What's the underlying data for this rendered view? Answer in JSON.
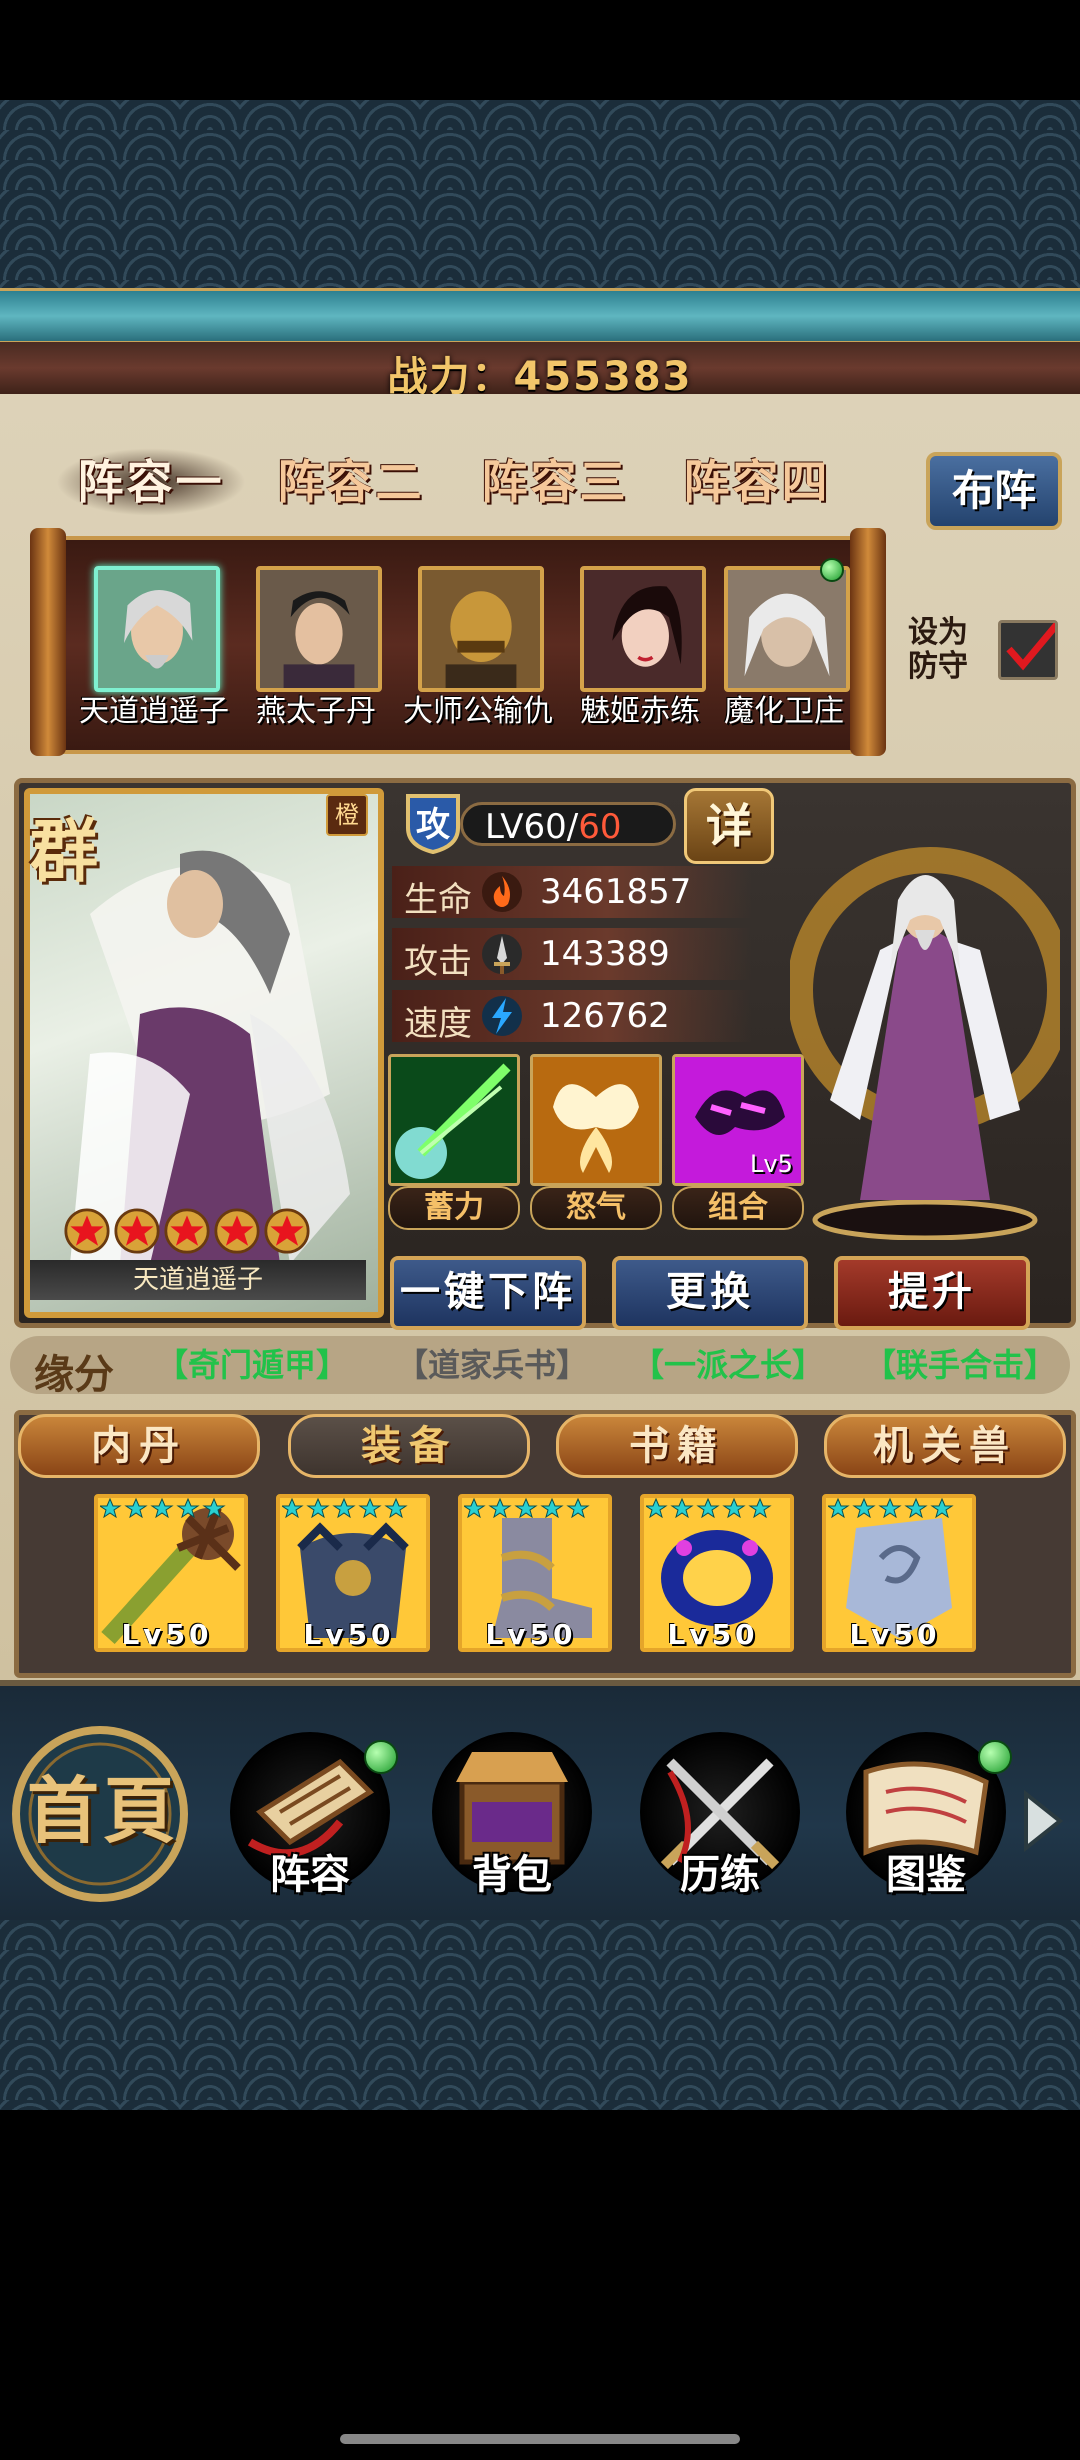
{
  "power": {
    "text": "战力：455383"
  },
  "lineup_tabs": [
    "阵容一",
    "阵容二",
    "阵容三",
    "阵容四"
  ],
  "layout_button": "布阵",
  "roster": [
    {
      "name": "天道逍遥子"
    },
    {
      "name": "燕太子丹"
    },
    {
      "name": "大师公输仇"
    },
    {
      "name": "魅姬赤练"
    },
    {
      "name": "魔化卫庄"
    }
  ],
  "defense": {
    "label": "设为防守"
  },
  "hero": {
    "faction": "群",
    "rarity": "橙",
    "name": "天道逍遥子",
    "stars": 5,
    "role_badge": "攻",
    "level_prefix": "LV60/",
    "level_max": "60",
    "detail_button": "详",
    "stats": [
      {
        "label": "生命",
        "value": "3461857",
        "icon": "flame-icon"
      },
      {
        "label": "攻击",
        "value": "143389",
        "icon": "sword-icon"
      },
      {
        "label": "速度",
        "value": "126762",
        "icon": "lightning-icon"
      }
    ],
    "skills": [
      {
        "label": "蓄力"
      },
      {
        "label": "怒气"
      },
      {
        "label": "组合",
        "level": "Lv5"
      }
    ],
    "actions": {
      "unequip_all": "一键下阵",
      "replace": "更换",
      "upgrade": "提升"
    }
  },
  "bonds": {
    "label": "缘分",
    "items": [
      {
        "text": "【奇门遁甲】",
        "active": true
      },
      {
        "text": "【道家兵书】",
        "active": false
      },
      {
        "text": "【一派之长】",
        "active": true
      },
      {
        "text": "【联手合击】",
        "active": true
      }
    ]
  },
  "equip_tabs": [
    "内丹",
    "装备",
    "书籍",
    "机关兽"
  ],
  "equipment": [
    {
      "level": "Lv50",
      "icon": "spear-icon"
    },
    {
      "level": "Lv50",
      "icon": "armor-icon"
    },
    {
      "level": "Lv50",
      "icon": "boots-icon"
    },
    {
      "level": "Lv50",
      "icon": "ring-icon"
    },
    {
      "level": "Lv50",
      "icon": "amulet-icon"
    }
  ],
  "nav": {
    "home": "首頁",
    "items": [
      "阵容",
      "背包",
      "历练",
      "图鉴"
    ]
  },
  "colors": {
    "active_bond": "#22c24a",
    "inactive_bond": "#5a5a5a",
    "gold": "#f2c66a"
  }
}
